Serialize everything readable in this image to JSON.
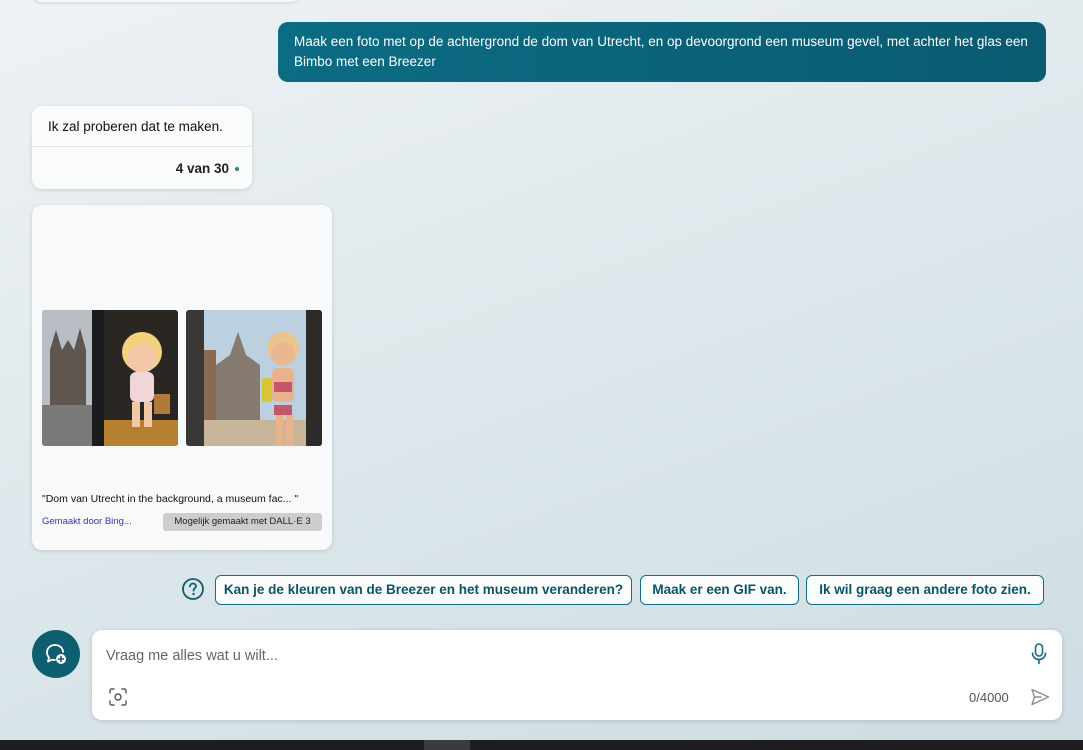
{
  "conversation": {
    "user_message": "Maak een foto met op de achtergrond de dom van Utrecht, en op devoorgrond een museum gevel, met achter het glas een Bimbo met een Breezer",
    "bot_message": "Ik zal proberen dat te maken.",
    "turn_counter": "4 van 30"
  },
  "image_card": {
    "caption": "\"Dom van Utrecht in the background, a museum fac... \"",
    "made_by": "Gemaakt door Bing...",
    "badge": "Mogelijk gemaakt met DALL·E 3"
  },
  "suggestions": [
    "Kan je de kleuren van de Breezer en het museum veranderen?",
    "Maak er een GIF van.",
    "Ik wil graag een andere foto zien."
  ],
  "composer": {
    "placeholder": "Vraag me alles wat u wilt...",
    "counter": "0/4000"
  },
  "icons": {
    "suggest": "question-circle-icon",
    "new_topic": "chat-plus-icon",
    "mic": "microphone-icon",
    "scan": "visual-search-icon",
    "send": "send-icon"
  },
  "colors": {
    "user_bubble": "#0b6c84",
    "accent": "#136f86",
    "new_topic_button": "#0d5f70"
  }
}
